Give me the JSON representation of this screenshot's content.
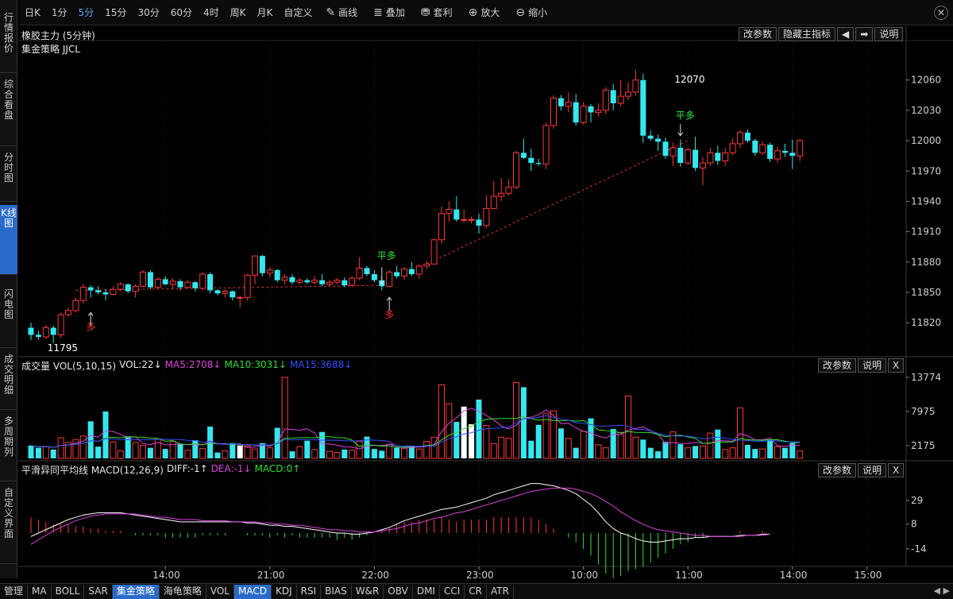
{
  "toolbar": {
    "periods": [
      {
        "label": "日K",
        "active": false
      },
      {
        "label": "1分",
        "active": false
      },
      {
        "label": "5分",
        "active": true
      },
      {
        "label": "15分",
        "active": false
      },
      {
        "label": "30分",
        "active": false
      },
      {
        "label": "60分",
        "active": false
      },
      {
        "label": "4时",
        "active": false
      },
      {
        "label": "周K",
        "active": false
      },
      {
        "label": "月K",
        "active": false
      },
      {
        "label": "自定义",
        "active": false
      }
    ],
    "tools": [
      {
        "label": "画线",
        "icon": "pencil-icon",
        "glyph": "✎"
      },
      {
        "label": "叠加",
        "icon": "stack-icon",
        "glyph": "≣"
      },
      {
        "label": "套利",
        "icon": "arbitrage-icon",
        "glyph": "⛃"
      },
      {
        "label": "放大",
        "icon": "zoom-in-icon",
        "glyph": "⊕"
      },
      {
        "label": "缩小",
        "icon": "zoom-out-icon",
        "glyph": "⊖"
      }
    ],
    "close_glyph": "✕"
  },
  "leftnav": [
    {
      "label": "行情报价",
      "active": false
    },
    {
      "label": "综合看盘",
      "active": false
    },
    {
      "label": "分时图",
      "active": false
    },
    {
      "label": "K线图",
      "active": true
    },
    {
      "label": "闪电图",
      "active": false
    },
    {
      "label": "成交明细",
      "active": false
    },
    {
      "label": "多周期列",
      "active": false
    },
    {
      "label": "自定义界面",
      "active": false
    }
  ],
  "kline": {
    "title": "橡胶主力 (5分钟)",
    "strategy": "集金策略 JJCL",
    "buttons": {
      "params": "改参数",
      "hide": "隐藏主指标",
      "prev": "◀",
      "next": "➡",
      "help": "说明"
    },
    "y_ticks": [
      "12060",
      "12030",
      "12000",
      "11970",
      "11940",
      "11910",
      "11880",
      "11850",
      "11820"
    ],
    "high_label": "12070",
    "low_label": "11795",
    "signals": [
      {
        "label": "平多",
        "color": "#2ee83a"
      },
      {
        "label": "多",
        "color": "#ff3030"
      },
      {
        "label": "平多",
        "color": "#2ee83a"
      },
      {
        "label": "多",
        "color": "#ff3030"
      }
    ]
  },
  "volume": {
    "title": "成交量 VOL(5,10,15)",
    "vol": "VOL:22↓",
    "ma5": "MA5:2708↓",
    "ma10": "MA10:3031↓",
    "ma15": "MA15:3688↓",
    "colors": {
      "ma5": "#e040e0",
      "ma10": "#30e030",
      "ma15": "#3050ff"
    },
    "buttons": {
      "params": "改参数",
      "help": "说明",
      "close": "X"
    },
    "y_ticks": [
      "13774",
      "7975",
      "2175"
    ]
  },
  "macd": {
    "title": "平滑异同平均线 MACD(12,26,9)",
    "diff": "DIFF:-1↑",
    "dea": "DEA:-1↓",
    "macd": "MACD:0↑",
    "colors": {
      "diff": "#ffffff",
      "dea": "#e040e0",
      "macd": "#30e030"
    },
    "buttons": {
      "params": "改参数",
      "help": "说明",
      "close": "X"
    },
    "y_ticks": [
      "29",
      "8",
      "-14"
    ]
  },
  "xaxis": [
    "14:00",
    "21:00",
    "22:00",
    "23:00",
    "10:00",
    "11:00",
    "14:00",
    "15:00"
  ],
  "bottombar": [
    {
      "label": "管理",
      "hl": false
    },
    {
      "label": "MA",
      "hl": false
    },
    {
      "label": "BOLL",
      "hl": false
    },
    {
      "label": "SAR",
      "hl": false
    },
    {
      "label": "集金策略",
      "hl": true
    },
    {
      "label": "海龟策略",
      "hl": false
    },
    {
      "label": "VOL",
      "hl": false
    },
    {
      "label": "MACD",
      "hl": true
    },
    {
      "label": "KDJ",
      "hl": false
    },
    {
      "label": "RSI",
      "hl": false
    },
    {
      "label": "BIAS",
      "hl": false
    },
    {
      "label": "W&R",
      "hl": false
    },
    {
      "label": "OBV",
      "hl": false
    },
    {
      "label": "DMI",
      "hl": false
    },
    {
      "label": "CCI",
      "hl": false
    },
    {
      "label": "CR",
      "hl": false
    },
    {
      "label": "ATR",
      "hl": false
    }
  ],
  "bottom_arrows": "◀ ▶",
  "chart_data": {
    "type": "candlestick",
    "symbol": "橡胶主力",
    "period": "5分钟",
    "ylim": [
      11795,
      12070
    ],
    "ohlc": [
      [
        11815,
        11820,
        11803,
        11808
      ],
      [
        11808,
        11812,
        11803,
        11806
      ],
      [
        11806,
        11818,
        11804,
        11815
      ],
      [
        11815,
        11817,
        11800,
        11808
      ],
      [
        11808,
        11830,
        11805,
        11828
      ],
      [
        11828,
        11835,
        11826,
        11832
      ],
      [
        11832,
        11845,
        11830,
        11842
      ],
      [
        11842,
        11858,
        11839,
        11855
      ],
      [
        11855,
        11857,
        11845,
        11852
      ],
      [
        11852,
        11856,
        11848,
        11850
      ],
      [
        11850,
        11853,
        11842,
        11848
      ],
      [
        11848,
        11856,
        11847,
        11853
      ],
      [
        11853,
        11860,
        11851,
        11858
      ],
      [
        11858,
        11859,
        11849,
        11851
      ],
      [
        11851,
        11858,
        11845,
        11856
      ],
      [
        11856,
        11872,
        11855,
        11870
      ],
      [
        11870,
        11872,
        11853,
        11855
      ],
      [
        11855,
        11865,
        11853,
        11863
      ],
      [
        11863,
        11866,
        11857,
        11858
      ],
      [
        11858,
        11864,
        11853,
        11861
      ],
      [
        11861,
        11863,
        11852,
        11855
      ],
      [
        11855,
        11862,
        11854,
        11860
      ],
      [
        11860,
        11861,
        11851,
        11854
      ],
      [
        11854,
        11870,
        11852,
        11868
      ],
      [
        11868,
        11870,
        11849,
        11852
      ],
      [
        11852,
        11853,
        11847,
        11849
      ],
      [
        11849,
        11853,
        11845,
        11851
      ],
      [
        11851,
        11852,
        11842,
        11845
      ],
      [
        11845,
        11847,
        11835,
        11845
      ],
      [
        11845,
        11868,
        11842,
        11867
      ],
      [
        11867,
        11872,
        11858,
        11886
      ],
      [
        11886,
        11887,
        11866,
        11869
      ],
      [
        11869,
        11875,
        11865,
        11872
      ],
      [
        11872,
        11873,
        11860,
        11862
      ],
      [
        11862,
        11868,
        11858,
        11865
      ],
      [
        11865,
        11868,
        11858,
        11860
      ],
      [
        11860,
        11864,
        11858,
        11862
      ],
      [
        11862,
        11864,
        11858,
        11860
      ],
      [
        11860,
        11866,
        11858,
        11862
      ],
      [
        11862,
        11868,
        11856,
        11858
      ],
      [
        11858,
        11862,
        11856,
        11860
      ],
      [
        11860,
        11864,
        11858,
        11862
      ],
      [
        11862,
        11865,
        11855,
        11857
      ],
      [
        11857,
        11866,
        11855,
        11864
      ],
      [
        11864,
        11885,
        11862,
        11874
      ],
      [
        11874,
        11876,
        11866,
        11868
      ],
      [
        11868,
        11872,
        11860,
        11862
      ],
      [
        11862,
        11866,
        11852,
        11856
      ],
      [
        11856,
        11872,
        11855,
        11870
      ],
      [
        11870,
        11876,
        11864,
        11866
      ],
      [
        11866,
        11875,
        11862,
        11873
      ],
      [
        11873,
        11880,
        11866,
        11868
      ],
      [
        11868,
        11878,
        11864,
        11876
      ],
      [
        11876,
        11881,
        11873,
        11878
      ],
      [
        11878,
        11903,
        11878,
        11902
      ],
      [
        11902,
        11935,
        11898,
        11928
      ],
      [
        11928,
        11940,
        11920,
        11932
      ],
      [
        11932,
        11945,
        11920,
        11922
      ],
      [
        11922,
        11932,
        11919,
        11922
      ],
      [
        11922,
        11925,
        11918,
        11922
      ],
      [
        11922,
        11928,
        11908,
        11916
      ],
      [
        11916,
        11946,
        11914,
        11933
      ],
      [
        11933,
        11960,
        11932,
        11945
      ],
      [
        11945,
        11963,
        11940,
        11948
      ],
      [
        11948,
        11962,
        11946,
        11954
      ],
      [
        11954,
        11990,
        11952,
        11988
      ],
      [
        11988,
        12002,
        11982,
        11983
      ],
      [
        11983,
        11992,
        11970,
        11978
      ],
      [
        11978,
        11982,
        11975,
        11977
      ],
      [
        11977,
        12018,
        11972,
        12015
      ],
      [
        12015,
        12045,
        12012,
        12042
      ],
      [
        12042,
        12045,
        12030,
        12034
      ],
      [
        12034,
        12048,
        12028,
        12038
      ],
      [
        12038,
        12046,
        12015,
        12018
      ],
      [
        12018,
        12038,
        12016,
        12034
      ],
      [
        12034,
        12036,
        12018,
        12028
      ],
      [
        12028,
        12037,
        12024,
        12030
      ],
      [
        12030,
        12053,
        12026,
        12050
      ],
      [
        12050,
        12056,
        12030,
        12037
      ],
      [
        12037,
        12060,
        12034,
        12044
      ],
      [
        12044,
        12058,
        12040,
        12048
      ],
      [
        12048,
        12070,
        12045,
        12060
      ],
      [
        12060,
        12066,
        11998,
        12005
      ],
      [
        12005,
        12010,
        12000,
        12002
      ],
      [
        12002,
        12006,
        11990,
        11999
      ],
      [
        11999,
        12003,
        11982,
        11985
      ],
      [
        11985,
        11998,
        11975,
        11993
      ],
      [
        11993,
        12001,
        11974,
        11978
      ],
      [
        11978,
        11993,
        11976,
        11991
      ],
      [
        11991,
        12004,
        11970,
        11973
      ],
      [
        11973,
        11984,
        11956,
        11978
      ],
      [
        11978,
        11993,
        11975,
        11988
      ],
      [
        11988,
        11995,
        11976,
        11980
      ],
      [
        11980,
        11993,
        11975,
        11988
      ],
      [
        11988,
        12002,
        11986,
        11997
      ],
      [
        11997,
        12010,
        11993,
        12008
      ],
      [
        12008,
        12011,
        11998,
        12000
      ],
      [
        12000,
        12002,
        11985,
        11988
      ],
      [
        11988,
        11999,
        11986,
        11996
      ],
      [
        11996,
        11998,
        11979,
        11982
      ],
      [
        11982,
        11994,
        11978,
        11990
      ],
      [
        11990,
        11997,
        11984,
        11988
      ],
      [
        11988,
        12001,
        11972,
        11985
      ],
      [
        11985,
        12002,
        11980,
        12000
      ]
    ],
    "volume": [
      2175,
      1800,
      2000,
      1500,
      3500,
      2700,
      3200,
      3800,
      6300,
      2000,
      7975,
      2800,
      1300,
      3600,
      2700,
      2200,
      1800,
      3300,
      1600,
      2900,
      2500,
      1400,
      3100,
      1700,
      5400,
      1000,
      1300,
      2600,
      2200,
      2100,
      1600,
      2600,
      1800,
      5200,
      13774,
      1200,
      2000,
      3000,
      1500,
      4500,
      1200,
      1000,
      1500,
      1400,
      2900,
      3700,
      1600,
      1300,
      2400,
      1800,
      1700,
      2100,
      1600,
      2900,
      3600,
      12500,
      9300,
      6200,
      8800,
      5800,
      10000,
      5600,
      2500,
      3600,
      3400,
      12900,
      12100,
      3000,
      5700,
      7600,
      8100,
      5100,
      3400,
      1800,
      4600,
      6800,
      2300,
      1800,
      5000,
      4400,
      10600,
      3600,
      3200,
      1800,
      1200,
      2800,
      4500,
      2400,
      1800,
      2100,
      2100,
      4300,
      4900,
      1500,
      1800,
      8600,
      2300,
      1600,
      1600,
      3200,
      2000,
      1800,
      2600,
      1300,
      1000,
      2800,
      4700
    ],
    "macd_diff": [
      -3,
      0,
      3,
      6,
      9,
      12,
      14,
      16,
      17,
      18,
      18,
      18,
      18,
      17,
      16,
      15,
      14,
      13,
      12,
      11,
      10,
      10,
      10,
      10,
      10,
      10,
      10,
      10,
      10,
      9,
      9,
      8,
      7,
      7,
      6,
      6,
      5,
      4,
      3,
      2,
      1,
      0,
      0,
      -1,
      -1,
      0,
      1,
      3,
      5,
      8,
      11,
      13,
      15,
      17,
      19,
      21,
      22,
      23,
      25,
      27,
      29,
      31,
      34,
      36,
      38,
      40,
      42,
      44,
      44,
      43,
      42,
      40,
      38,
      35,
      30,
      25,
      18,
      10,
      4,
      0,
      -2,
      -5,
      -7,
      -8,
      -8,
      -7,
      -6,
      -5,
      -5,
      -4,
      -4,
      -3,
      -3,
      -3,
      -3,
      -2,
      -2,
      -2,
      -1,
      -1
    ],
    "macd_dea": [
      -10,
      -6,
      -2,
      2,
      5,
      8,
      11,
      13,
      15,
      16,
      17,
      17,
      17,
      17,
      17,
      16,
      15,
      14,
      14,
      13,
      12,
      12,
      12,
      11,
      11,
      11,
      11,
      10,
      10,
      10,
      10,
      9,
      9,
      8,
      8,
      7,
      7,
      6,
      5,
      4,
      3,
      3,
      2,
      2,
      1,
      1,
      1,
      2,
      3,
      4,
      6,
      8,
      9,
      11,
      13,
      14,
      16,
      18,
      19,
      21,
      23,
      25,
      27,
      29,
      31,
      33,
      35,
      37,
      38,
      39,
      40,
      40,
      40,
      39,
      37,
      35,
      32,
      28,
      24,
      19,
      15,
      11,
      8,
      5,
      3,
      2,
      1,
      0,
      -1,
      -2,
      -2,
      -3,
      -3,
      -3,
      -3,
      -3,
      -2,
      -2,
      -2,
      -1
    ]
  }
}
